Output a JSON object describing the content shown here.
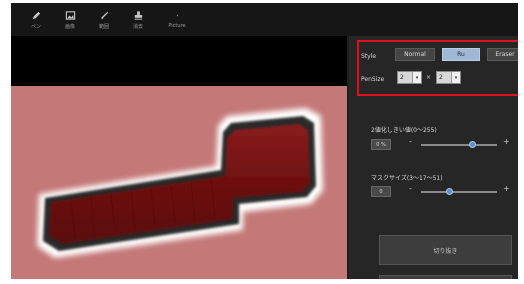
{
  "toolbar": {
    "items": [
      {
        "icon": "pen-icon",
        "label": "ペン"
      },
      {
        "icon": "image-icon",
        "label": "画像"
      },
      {
        "icon": "brush-icon",
        "label": "範囲"
      },
      {
        "icon": "stamp-icon",
        "label": "消去"
      },
      {
        "icon": "",
        "label": "Picture"
      }
    ]
  },
  "style": {
    "label": "Style",
    "options": [
      "Normal",
      "Ru",
      "Eraser"
    ],
    "selected": "Ru"
  },
  "pen_size": {
    "label": "PenSize",
    "width": "2",
    "height": "2",
    "separator": "×"
  },
  "slider1": {
    "label": "2値化しきい値(0～255)",
    "button": "0 %",
    "minus": "-",
    "plus": "+",
    "value_fraction": 0.68
  },
  "slider2": {
    "label": "マスクサイズ(3～17～51)",
    "button": "0",
    "minus": "-",
    "plus": "+",
    "value_fraction": 0.38
  },
  "action_button": {
    "label": "切り抜き"
  },
  "colors": {
    "accent": "#9fb8d6",
    "highlight": "#e0101a",
    "image_bg": "#c47878",
    "object": "#7a1414"
  }
}
